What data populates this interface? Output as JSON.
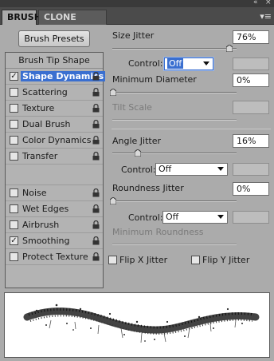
{
  "header": {
    "collapse_icon": "double-arrow-icon",
    "close_icon": "close-icon",
    "tabs": [
      {
        "label": "BRUSH",
        "active": true
      },
      {
        "label": "CLONE SOURCE",
        "active": false
      }
    ],
    "menu_icon": "panel-menu-icon"
  },
  "presets_button": "Brush Presets",
  "list": {
    "heading": "Brush Tip Shape",
    "items": [
      {
        "label": "Shape Dynamics",
        "checked": true,
        "selected": true
      },
      {
        "label": "Scattering",
        "checked": false
      },
      {
        "label": "Texture",
        "checked": false
      },
      {
        "label": "Dual Brush",
        "checked": false
      },
      {
        "label": "Color Dynamics",
        "checked": false
      },
      {
        "label": "Transfer",
        "checked": false
      },
      {
        "label": "Noise",
        "checked": false
      },
      {
        "label": "Wet Edges",
        "checked": false
      },
      {
        "label": "Airbrush",
        "checked": false
      },
      {
        "label": "Smoothing",
        "checked": true
      },
      {
        "label": "Protect Texture",
        "checked": false
      }
    ],
    "check_glyph": "✓"
  },
  "settings": {
    "size_jitter": {
      "label": "Size Jitter",
      "value": "76%",
      "slider": 0.76
    },
    "size_control": {
      "label": "Control:",
      "value": "Off"
    },
    "min_diameter": {
      "label": "Minimum Diameter",
      "value": "0%",
      "slider": 0
    },
    "tilt_scale": {
      "label": "Tilt Scale",
      "value": ""
    },
    "angle_jitter": {
      "label": "Angle Jitter",
      "value": "16%",
      "slider": 0.16
    },
    "angle_control": {
      "label": "Control:",
      "value": "Off"
    },
    "roundness_jitter": {
      "label": "Roundness Jitter",
      "value": "0%",
      "slider": 0
    },
    "roundness_control": {
      "label": "Control:",
      "value": "Off"
    },
    "min_roundness": {
      "label": "Minimum Roundness",
      "value": ""
    },
    "flip_x": {
      "label": "Flip X Jitter",
      "checked": false
    },
    "flip_y": {
      "label": "Flip Y Jitter",
      "checked": false
    }
  },
  "colors": {
    "panel_bg": "#ababab",
    "highlight": "#3a6fd0"
  }
}
